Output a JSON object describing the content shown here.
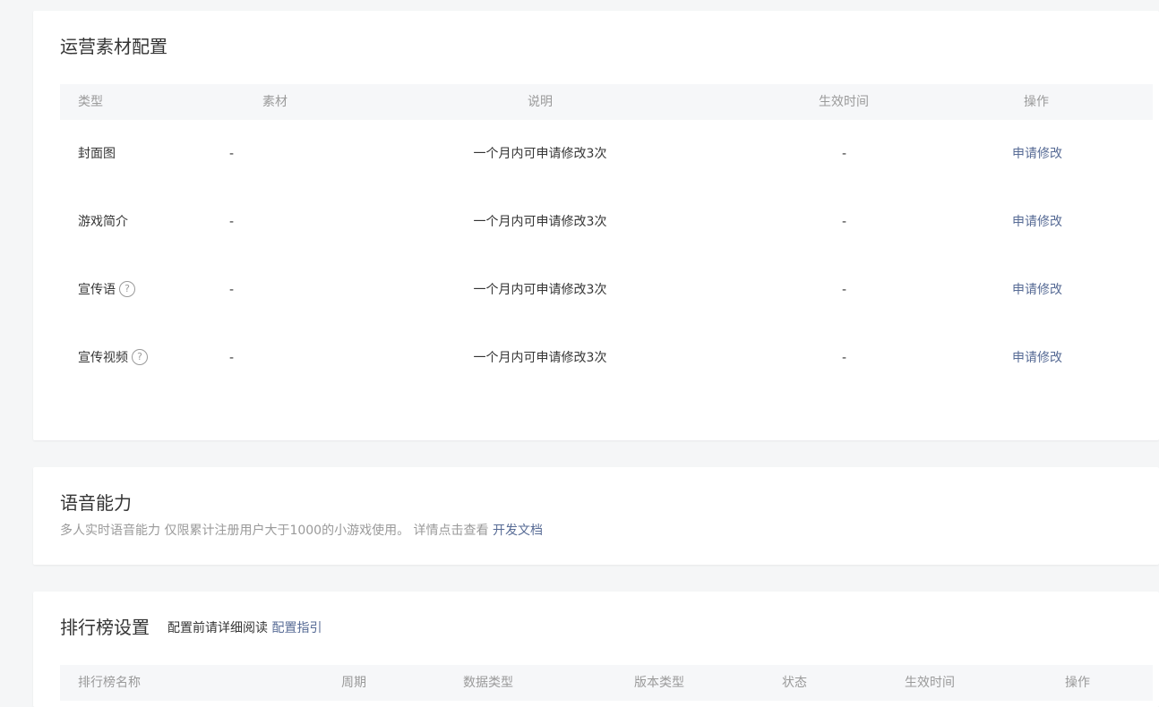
{
  "material": {
    "title": "运营素材配置",
    "columns": [
      "类型",
      "素材",
      "说明",
      "生效时间",
      "操作"
    ],
    "rows": [
      {
        "type": "封面图",
        "material": "-",
        "note": "一个月内可申请修改3次",
        "time": "-",
        "action": "申请修改",
        "help": ""
      },
      {
        "type": "游戏简介",
        "material": "-",
        "note": "一个月内可申请修改3次",
        "time": "-",
        "action": "申请修改",
        "help": ""
      },
      {
        "type": "宣传语",
        "material": "-",
        "note": "一个月内可申请修改3次",
        "time": "-",
        "action": "申请修改",
        "help": "?"
      },
      {
        "type": "宣传视频",
        "material": "-",
        "note": "一个月内可申请修改3次",
        "time": "-",
        "action": "申请修改",
        "help": "?"
      }
    ]
  },
  "voice": {
    "title": "语音能力",
    "desc": "多人实时语音能力 仅限累计注册用户大于1000的小游戏使用。 详情点击查看",
    "link": "开发文档"
  },
  "ranking": {
    "title": "排行榜设置",
    "hint": "配置前请详细阅读",
    "hint_link": "配置指引",
    "columns": [
      "排行榜名称",
      "周期",
      "数据类型",
      "版本类型",
      "状态",
      "生效时间",
      "操作"
    ]
  },
  "colors": {
    "link": "#576b95",
    "background": "#f5f6f7",
    "table_head": "#f6f7f9"
  }
}
